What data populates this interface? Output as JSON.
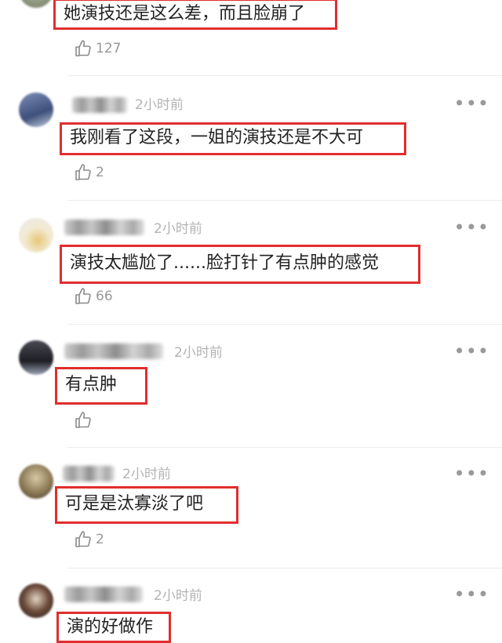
{
  "comments": [
    {
      "text": "她演技还是这么差，而且脸崩了",
      "likes": "127",
      "time": ""
    },
    {
      "text": "我刚看了这段，一姐的演技还是不大可",
      "likes": "2",
      "time": "2小时前"
    },
    {
      "text": "演技太尴尬了......脸打针了有点肿的感觉",
      "likes": "66",
      "time": "2小时前"
    },
    {
      "text": "有点肿",
      "likes": "",
      "time": "2小时前"
    },
    {
      "text": "可是是汰寡淡了吧",
      "likes": "2",
      "time": "2小时前"
    },
    {
      "text": "演的好做作",
      "likes": "",
      "time": "2小时前"
    }
  ],
  "icons": {
    "like": "thumbs-up-icon",
    "more": "more-dots-icon"
  },
  "colors": {
    "highlight_border": "#e02e2e",
    "meta_text": "#b3b3b3"
  }
}
